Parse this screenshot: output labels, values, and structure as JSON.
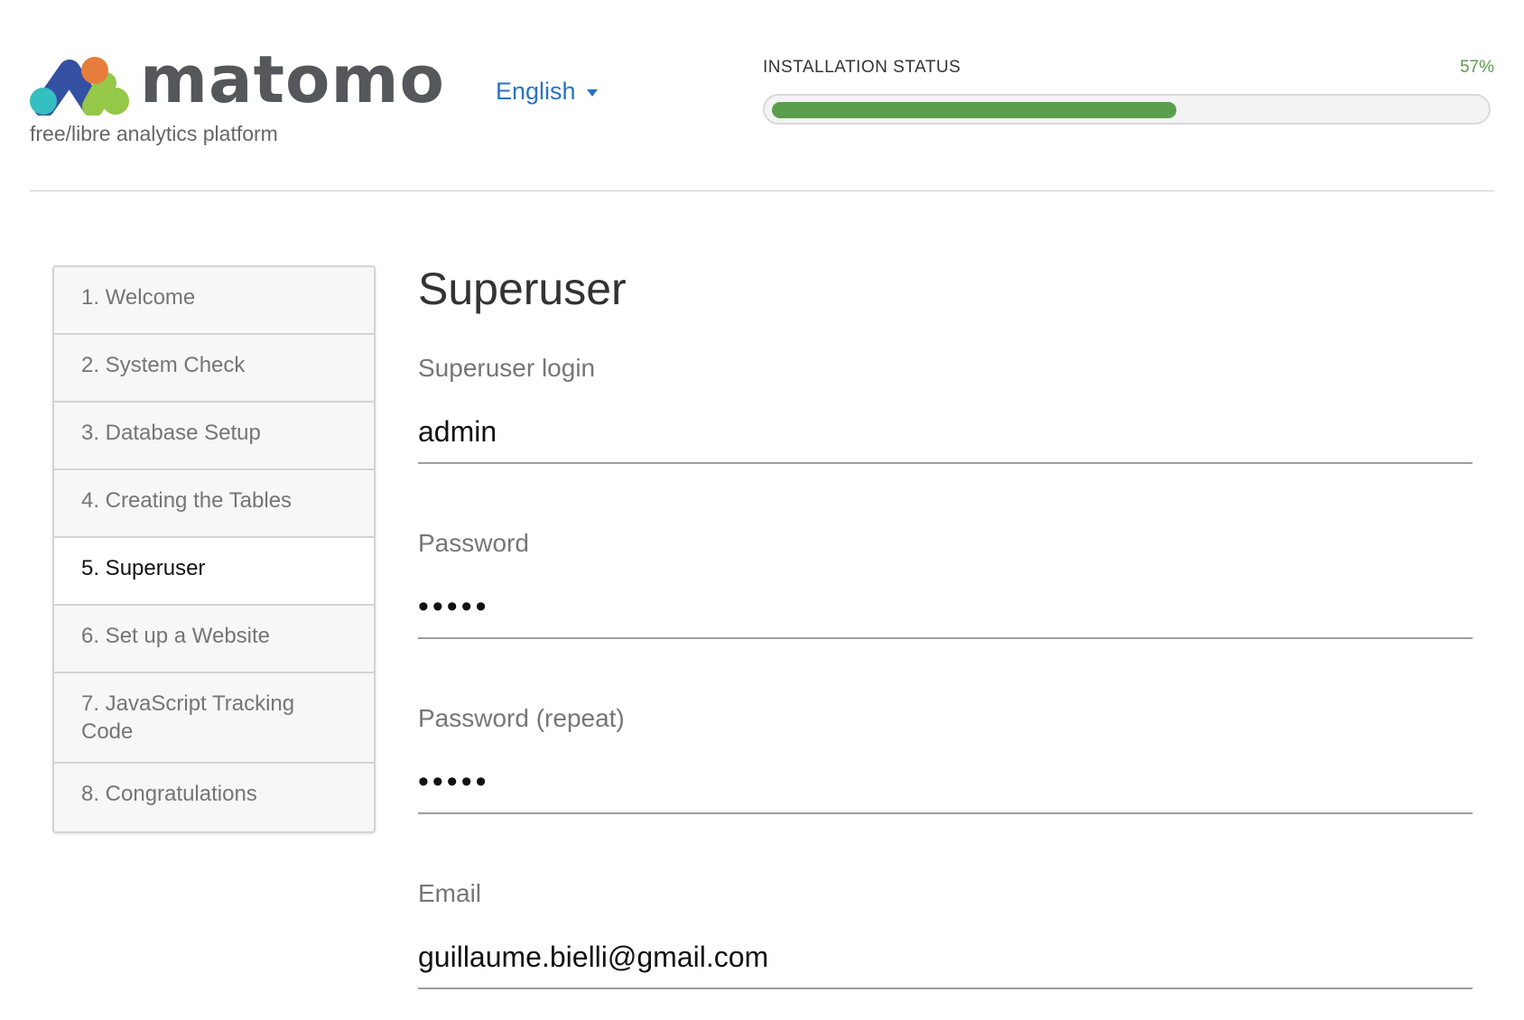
{
  "header": {
    "brand": "matomo",
    "tagline": "free/libre analytics platform",
    "language": "English",
    "logo_colors": [
      "#3450a3",
      "#e77d3a",
      "#95c748",
      "#35bfc0"
    ]
  },
  "installation_status": {
    "label": "INSTALLATION STATUS",
    "percent_text": "57%",
    "progress": 0.57,
    "accent_color": "#5a9e4e"
  },
  "steps": [
    {
      "label": "1. Welcome"
    },
    {
      "label": "2. System Check"
    },
    {
      "label": "3. Database Setup"
    },
    {
      "label": "4. Creating the Tables"
    },
    {
      "label": "5. Superuser",
      "current": true
    },
    {
      "label": "6. Set up a Website"
    },
    {
      "label": "7. JavaScript Tracking Code"
    },
    {
      "label": "8. Congratulations"
    }
  ],
  "form": {
    "title": "Superuser",
    "login": {
      "label": "Superuser login",
      "value": "admin"
    },
    "password": {
      "label": "Password",
      "value": "admin"
    },
    "password_repeat": {
      "label": "Password (repeat)",
      "value": "admin"
    },
    "email": {
      "label": "Email",
      "value": "guillaume.bielli@gmail.com"
    }
  }
}
